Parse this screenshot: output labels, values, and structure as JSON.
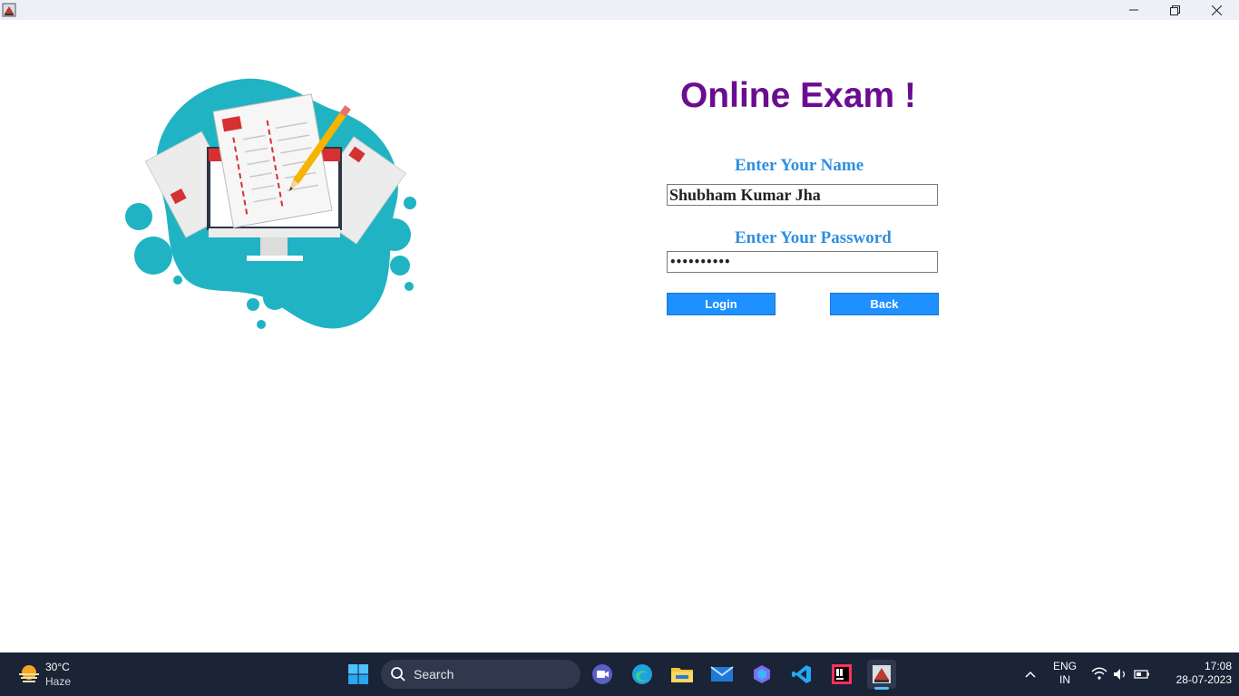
{
  "window": {
    "controls": {
      "minimize_icon": "minimize-icon",
      "restore_icon": "restore-icon",
      "close_icon": "close-icon"
    }
  },
  "form": {
    "title": "Online Exam !",
    "name_label": "Enter Your Name",
    "name_value": "Shubham Kumar Jha",
    "password_label": "Enter Your Password",
    "password_value": "••••••••••",
    "login_label": "Login",
    "back_label": "Back"
  },
  "colors": {
    "title": "#6a0d91",
    "label": "#2f8fe0",
    "button": "#1e90ff",
    "illustration_blob": "#20b3c3"
  },
  "taskbar": {
    "weather": {
      "temp": "30°C",
      "condition": "Haze"
    },
    "search_label": "Search",
    "apps": [
      "windows-start-icon",
      "meet-icon",
      "edge-icon",
      "file-explorer-icon",
      "mail-icon",
      "copilot-icon",
      "vscode-icon",
      "intellij-icon",
      "java-app-icon"
    ],
    "language": {
      "line1": "ENG",
      "line2": "IN"
    },
    "clock": {
      "time": "17:08",
      "date": "28-07-2023"
    }
  }
}
